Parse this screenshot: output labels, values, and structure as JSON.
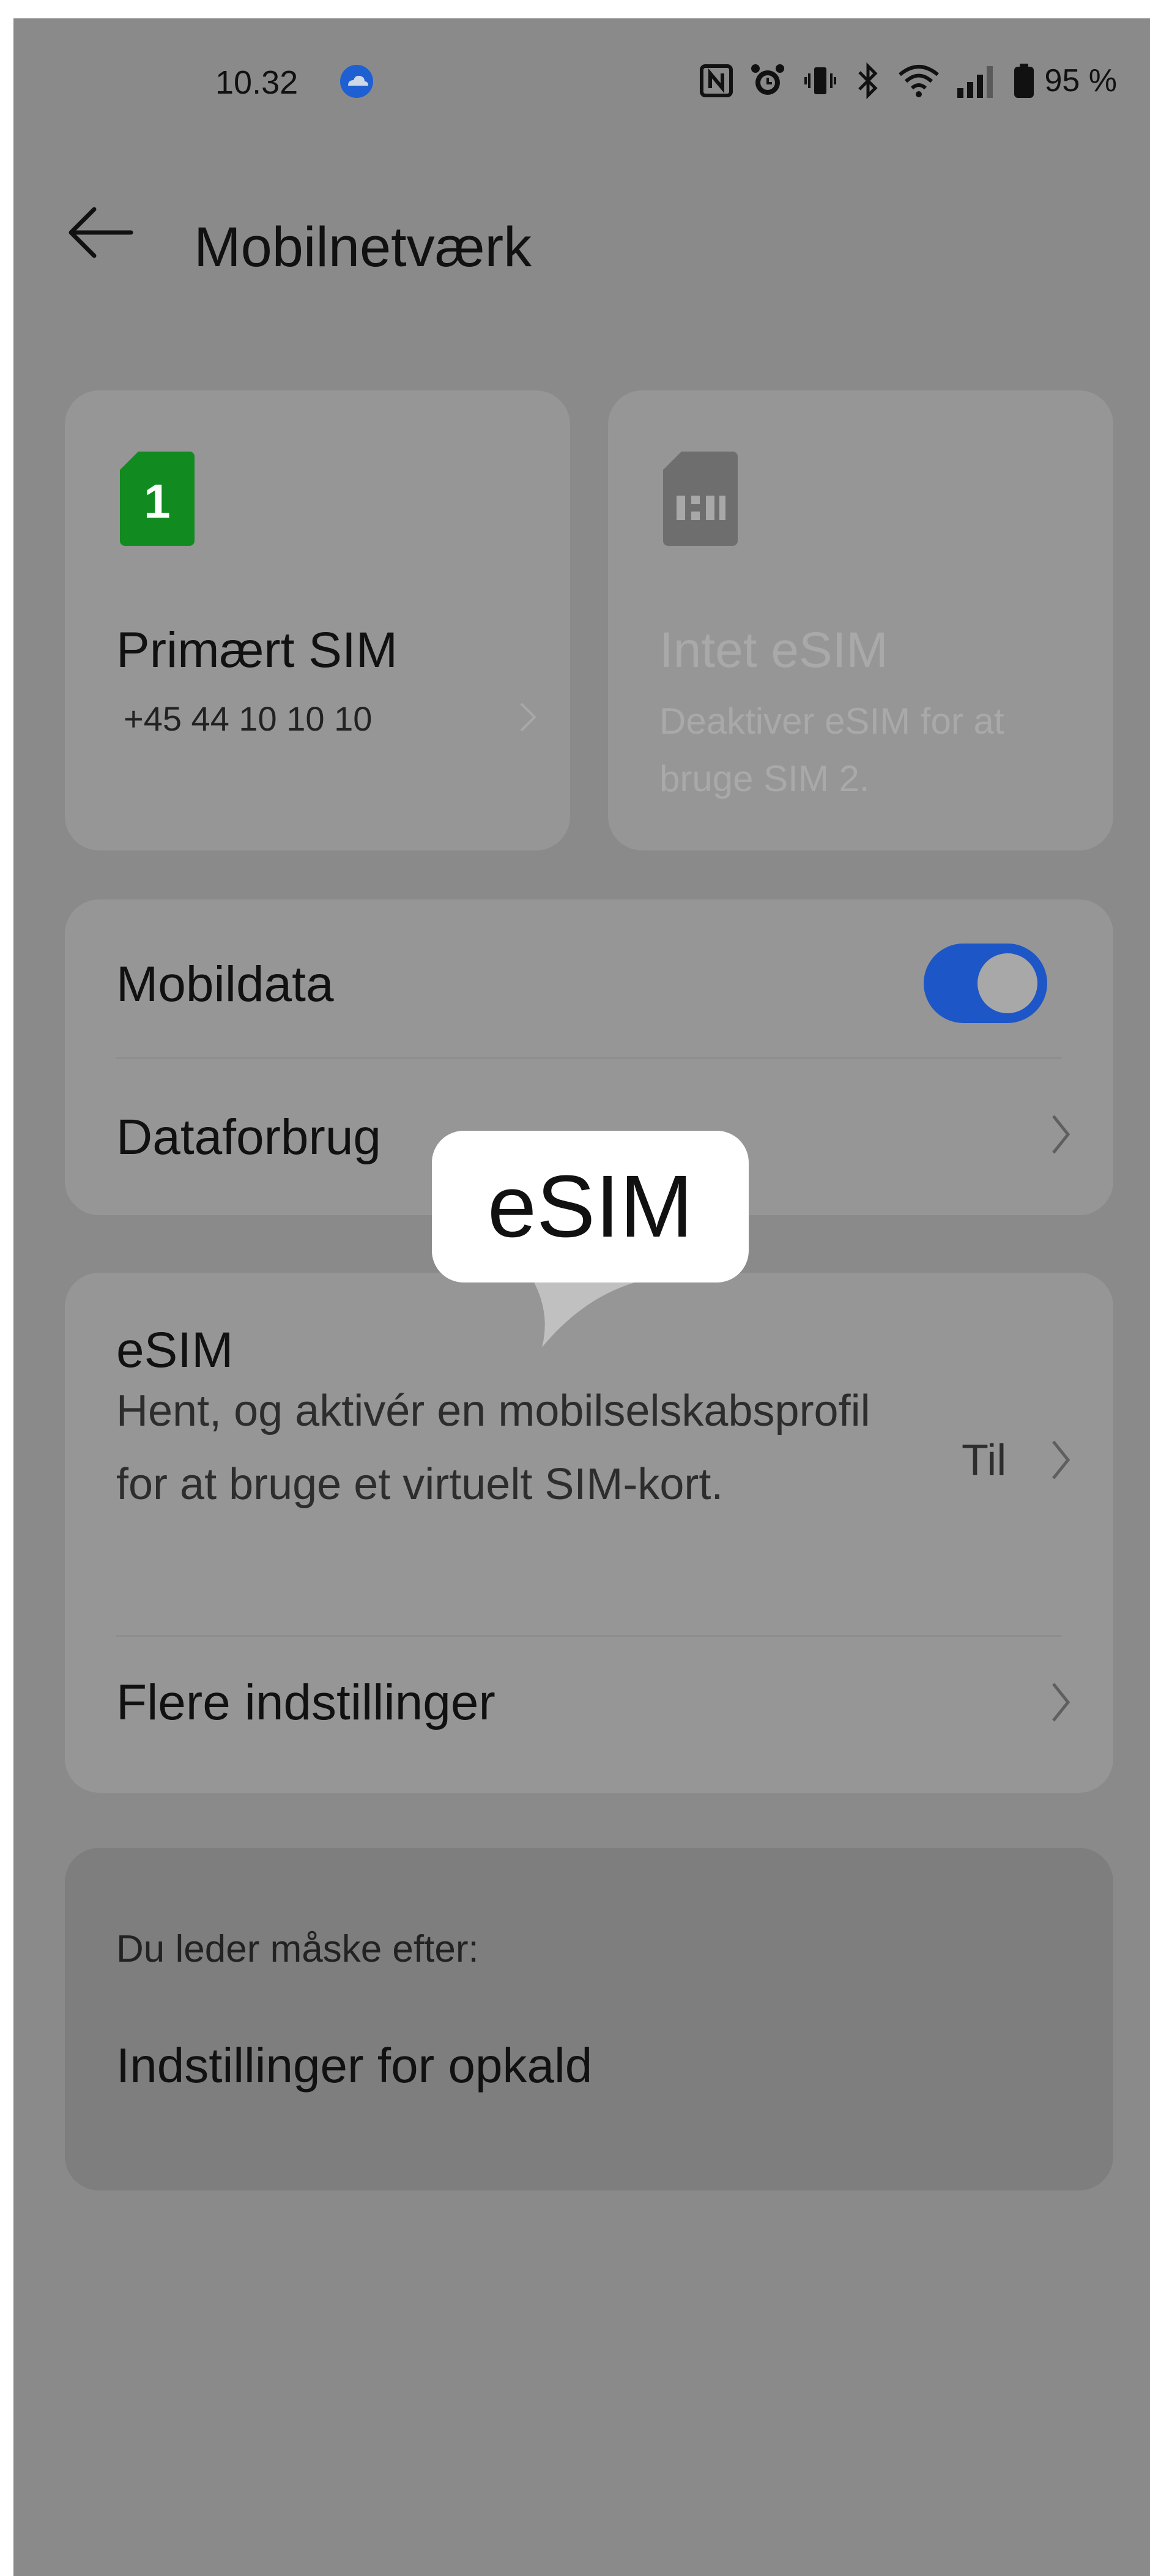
{
  "status_bar": {
    "time": "10.32",
    "battery": "95 %",
    "icons": [
      "cloud-icon",
      "nfc-icon",
      "alarm-icon",
      "vibrate-icon",
      "bluetooth-icon",
      "wifi-icon",
      "signal-icon",
      "battery-icon"
    ]
  },
  "header": {
    "title": "Mobilnetværk"
  },
  "sim_cards": [
    {
      "title": "Primært SIM",
      "subtitle": "+45 44 10 10 10",
      "icon_label": "1",
      "accent": "#118a20"
    },
    {
      "title": "Intet eSIM",
      "subtitle": "Deaktiver eSIM for at bruge SIM 2."
    }
  ],
  "data_section": {
    "mobile_data_label": "Mobildata",
    "mobile_data_on": true,
    "data_usage_label": "Dataforbrug"
  },
  "esim_section": {
    "title": "eSIM",
    "description": "Hent, og aktivér en mobilselskabsprofil for at bruge et virtuelt SIM-kort.",
    "status": "Til",
    "more_settings_label": "Flere indstillinger"
  },
  "suggestions": {
    "heading": "Du leder måske efter:",
    "item": "Indstillinger for opkald"
  },
  "tooltip": {
    "text": "eSIM"
  },
  "colors": {
    "overlay_background": "#8a8a8a",
    "toggle_on": "#1d56c6",
    "sim_green": "#118a20"
  }
}
